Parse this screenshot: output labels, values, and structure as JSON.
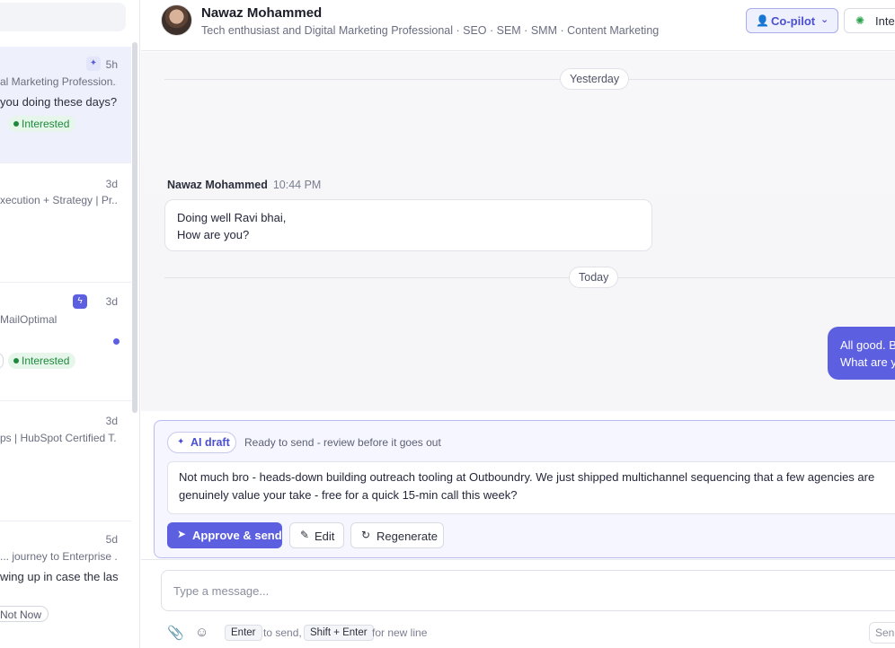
{
  "sidebar": {
    "conversations": [
      {
        "time": "5h",
        "subtitle": "al Marketing Profession...",
        "preview": "you doing these days?",
        "tag": "Interested"
      },
      {
        "time": "3d",
        "subtitle": "xecution + Strategy | Pr..."
      },
      {
        "time": "3d",
        "subtitle": "MailOptimal",
        "tag": "Interested"
      },
      {
        "time": "3d",
        "subtitle": "ps | HubSpot Certified T..."
      },
      {
        "time": "5d",
        "subtitle": "... journey to Enterprise ...",
        "preview": "wing up in case the last",
        "tag": "Not Now"
      }
    ]
  },
  "header": {
    "name": "Nawaz Mohammed",
    "headline": "Tech enthusiast and Digital Marketing Professional · SEO · SEM · SMM · Content Marketing",
    "copilot_label": "Co-pilot",
    "status_label": "Inte"
  },
  "chat": {
    "day_yesterday": "Yesterday",
    "day_today": "Today",
    "incoming": {
      "sender": "Nawaz Mohammed",
      "time": "10:44 PM",
      "line1": "Doing well Ravi bhai,",
      "line2": "How are you?"
    },
    "outgoing": {
      "line1": "All good. B",
      "line2": "What are y"
    }
  },
  "draft": {
    "badge": "AI draft",
    "status": "Ready to send - review before it goes out",
    "text_line1": "Not much bro - heads-down building outreach tooling at Outboundry. We just shipped multichannel sequencing that a few agencies are",
    "text_line2": "genuinely value your take - free for a quick 15-min call this week?",
    "approve_label": "Approve & send",
    "edit_label": "Edit",
    "regen_label": "Regenerate"
  },
  "composer": {
    "placeholder": "Type a message...",
    "key_enter": "Enter",
    "hint_send": "to send,",
    "key_shift_enter": "Shift + Enter",
    "hint_newline": "for new line",
    "send_label": "Send"
  },
  "colors": {
    "accent": "#5b5fe0",
    "interested": "#1d8a3b"
  }
}
